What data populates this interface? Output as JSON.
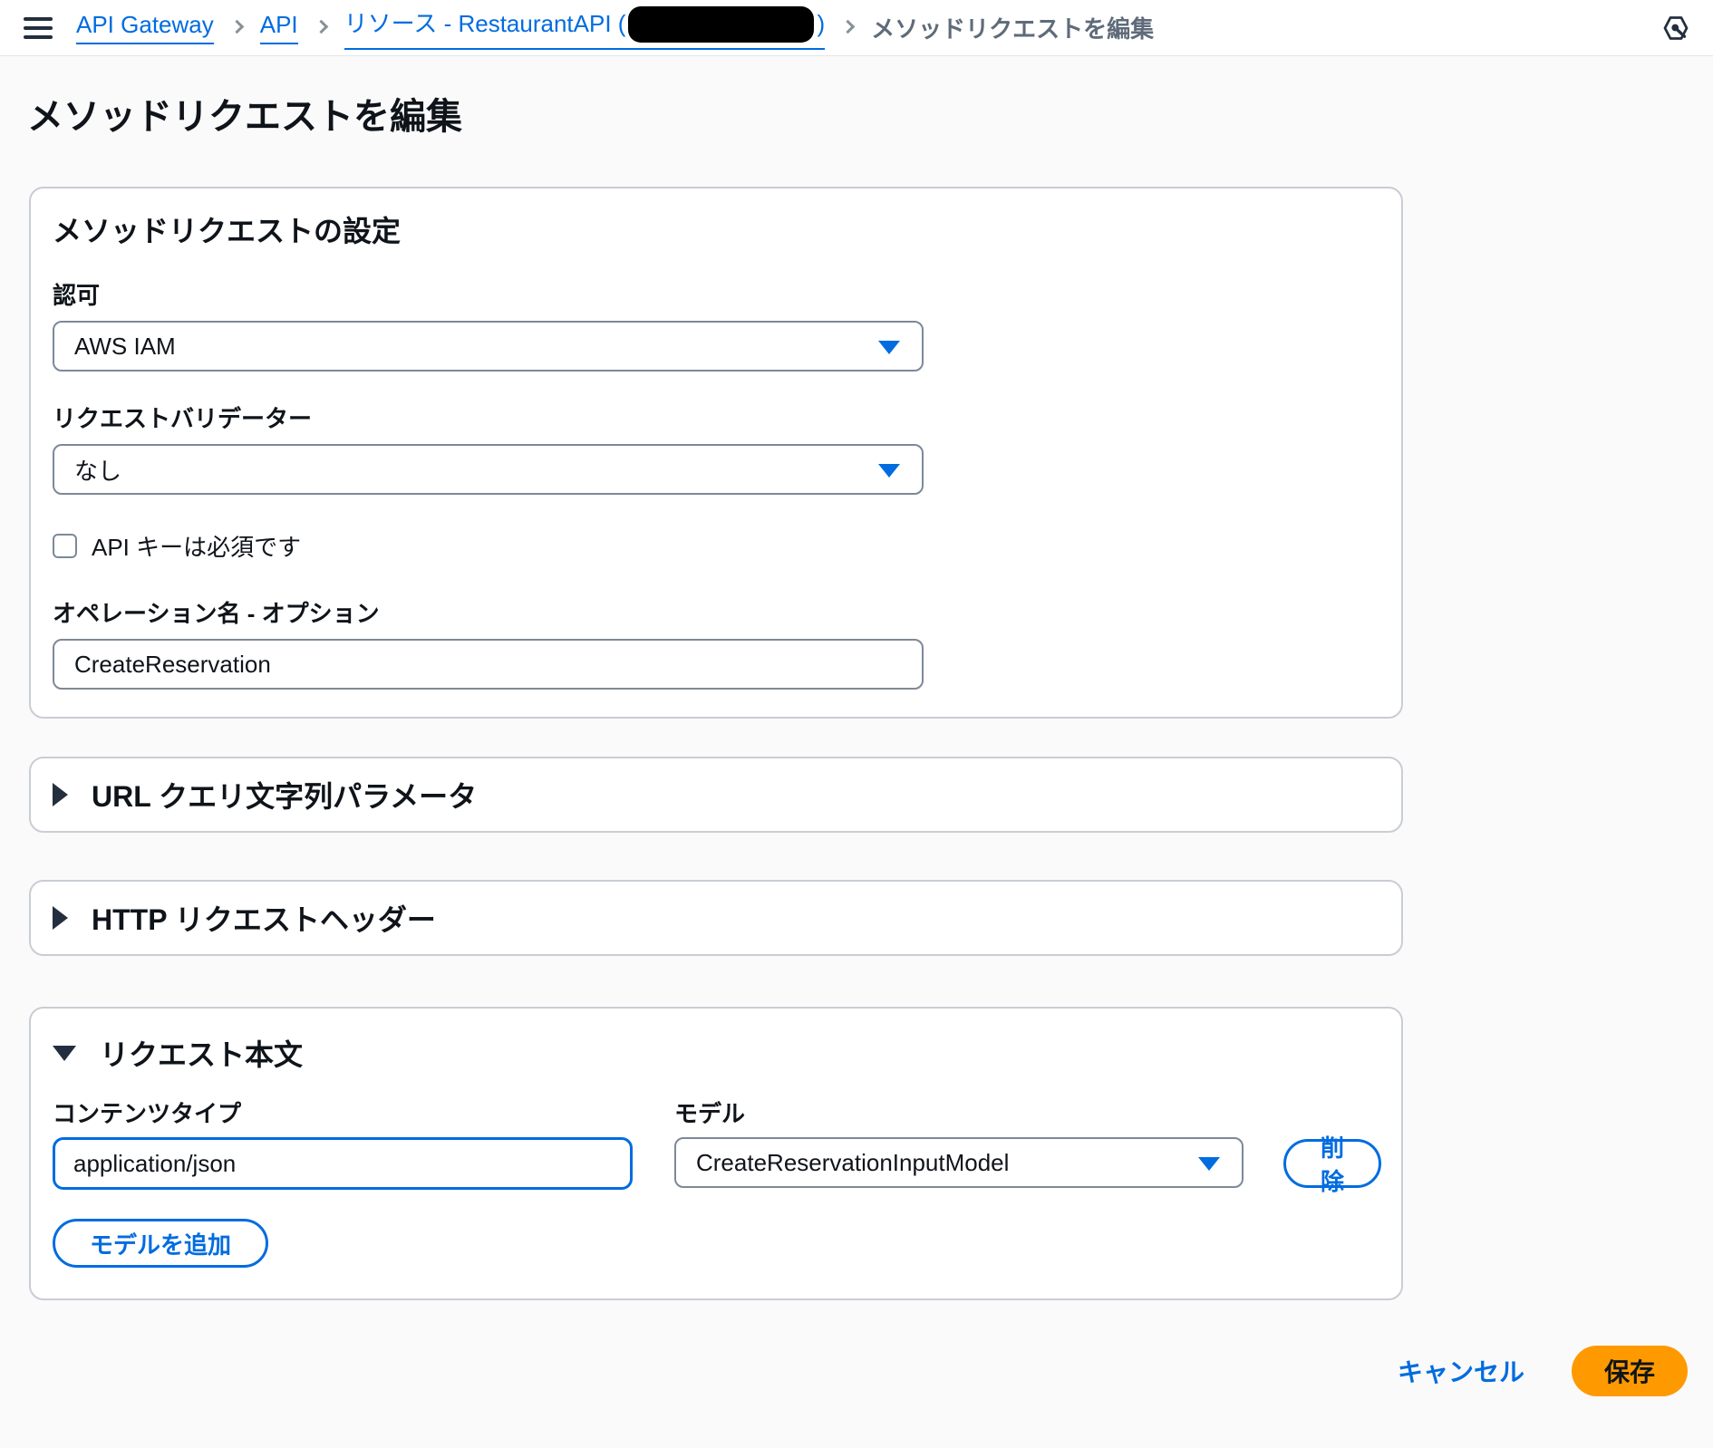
{
  "breadcrumb": {
    "api_gateway": "API Gateway",
    "api": "API",
    "resource_prefix": "リソース - RestaurantAPI (",
    "resource_suffix": ")",
    "current": "メソッドリクエストを編集"
  },
  "page": {
    "title": "メソッドリクエストを編集"
  },
  "settings": {
    "title": "メソッドリクエストの設定",
    "authorization": {
      "label": "認可",
      "value": "AWS IAM"
    },
    "request_validator": {
      "label": "リクエストバリデーター",
      "value": "なし"
    },
    "api_key": {
      "label": "API キーは必須です",
      "checked": false
    },
    "operation_name": {
      "label": "オペレーション名 - オプション",
      "value": "CreateReservation"
    }
  },
  "sections": {
    "url_query": {
      "title": "URL クエリ文字列パラメータ",
      "collapsed": true
    },
    "http_headers": {
      "title": "HTTP リクエストヘッダー",
      "collapsed": true
    },
    "request_body": {
      "title": "リクエスト本文",
      "collapsed": false,
      "content_type": {
        "label": "コンテンツタイプ",
        "value": "application/json"
      },
      "model": {
        "label": "モデル",
        "value": "CreateReservationInputModel"
      },
      "delete_button": "削除",
      "add_model_button": "モデルを追加"
    }
  },
  "footer": {
    "cancel": "キャンセル",
    "save": "保存"
  },
  "icons": {
    "menu": "hamburger-menu",
    "assistant": "amazon-q-hexagon",
    "dropdown": "caret-down-filled",
    "expand": "caret-right",
    "collapse": "caret-down"
  },
  "colors": {
    "accent_blue": "#006ce0",
    "save_orange": "#ff9900",
    "text_dark": "#0f141a",
    "breadcrumb_gray": "#5f6b7a"
  }
}
